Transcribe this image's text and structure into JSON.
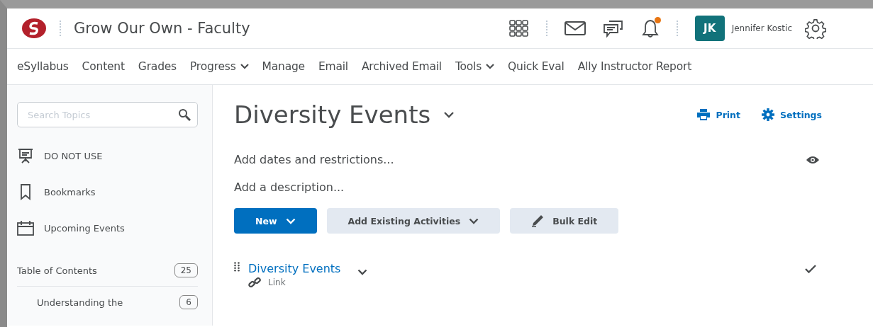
{
  "header": {
    "course_title": "Grow Our Own - Faculty",
    "notifications_unread": true,
    "user": {
      "initials": "JK",
      "name": "Jennifer Kostic"
    }
  },
  "nav": [
    {
      "label": "eSyllabus",
      "has_menu": false
    },
    {
      "label": "Content",
      "has_menu": false
    },
    {
      "label": "Grades",
      "has_menu": false
    },
    {
      "label": "Progress",
      "has_menu": true
    },
    {
      "label": "Manage",
      "has_menu": false
    },
    {
      "label": "Email",
      "has_menu": false
    },
    {
      "label": "Archived Email",
      "has_menu": false
    },
    {
      "label": "Tools",
      "has_menu": true
    },
    {
      "label": "Quick Eval",
      "has_menu": false
    },
    {
      "label": "Ally Instructor Report",
      "has_menu": false
    }
  ],
  "sidebar": {
    "search": {
      "placeholder": "Search Topics"
    },
    "items": [
      {
        "label": "DO NOT USE",
        "kind": "presentation"
      },
      {
        "label": "Bookmarks",
        "kind": "bookmark"
      },
      {
        "label": "Upcoming Events",
        "kind": "calendar"
      }
    ],
    "toc": {
      "label": "Table of Contents",
      "count": "25",
      "children": [
        {
          "label": "Understanding the",
          "count": "6"
        }
      ]
    }
  },
  "main": {
    "title": "Diversity Events",
    "actions": [
      "Print",
      "Settings"
    ],
    "dates_link": "Add dates and restrictions...",
    "description_link": "Add a description...",
    "buttons": [
      {
        "label": "New",
        "kind": "primary"
      },
      {
        "label": "Add Existing Activities",
        "kind": "menu"
      },
      {
        "label": "Bulk Edit",
        "kind": "edit"
      }
    ],
    "items": [
      {
        "title": "Diversity Events",
        "type": "Link",
        "completed": true
      }
    ]
  }
}
